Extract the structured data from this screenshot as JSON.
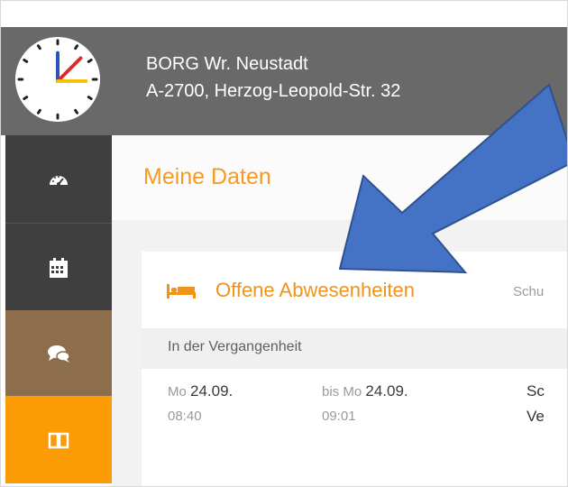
{
  "header": {
    "school_name": "BORG Wr. Neustadt",
    "school_address": "A-2700, Herzog-Leopold-Str. 32"
  },
  "sidebar": {
    "items": [
      {
        "icon": "dashboard-icon",
        "color": "#3f3f3f"
      },
      {
        "icon": "calendar-icon",
        "color": "#3f3f3f"
      },
      {
        "icon": "chat-icon",
        "color": "#8c6e4d"
      },
      {
        "icon": "book-icon",
        "color": "#fb9b06"
      }
    ]
  },
  "main": {
    "page_title": "Meine Daten",
    "tabs": [
      {
        "label": "Offene Abwesenheiten",
        "icon": "bed-icon",
        "active": true
      },
      {
        "label": "Schu",
        "active": false
      }
    ],
    "section_label": "In der Vergangenheit",
    "absence_row": {
      "start_day": "Mo",
      "start_date": "24.09.",
      "start_time": "08:40",
      "end_prefix": "bis Mo",
      "end_date": "24.09.",
      "end_time": "09:01",
      "col3_line1": "Sc",
      "col3_line2": "Ve"
    }
  },
  "colors": {
    "accent_orange": "#f59a22",
    "header_gray": "#696969",
    "annotation_arrow": "#4472c4"
  }
}
